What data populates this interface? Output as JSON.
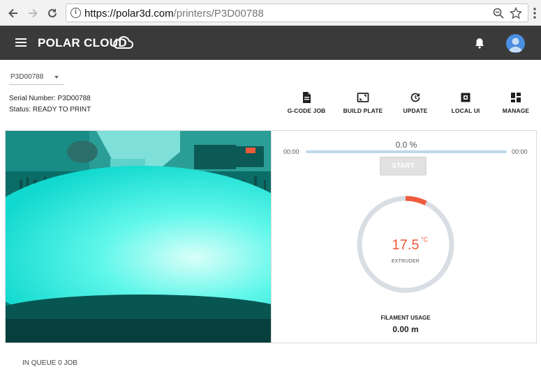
{
  "browser": {
    "url_host": "https://polar3d.com",
    "url_path": "/printers/P3D00788"
  },
  "header": {
    "brand": "POLAR CLOUD"
  },
  "printer": {
    "selected": "P3D00788",
    "serial_label": "Serial Number: P3D00788",
    "status_label": "Status: READY TO PRINT"
  },
  "actions": {
    "gcode": "G-CODE JOB",
    "build_plate": "BUILD PLATE",
    "update": "UPDATE",
    "local_ui": "LOCAL UI",
    "manage": "MANAGE"
  },
  "progress": {
    "percent_label": "0.0 %",
    "fraction": 0.0,
    "time_elapsed": "00:00",
    "time_remaining": "00:00",
    "start_label": "START"
  },
  "temperature": {
    "value": "17.5",
    "unit": "°C",
    "label": "EXTRUDER"
  },
  "filament": {
    "label": "FILAMENT USAGE",
    "value": "0.00 m"
  },
  "queue": {
    "label": "IN QUEUE 0 JOB"
  },
  "colors": {
    "header_bg": "#3a3a3a",
    "accent_red": "#ef5a3c",
    "progress_track": "#bcd9ec",
    "camera_tint": "#1ff0e0"
  }
}
